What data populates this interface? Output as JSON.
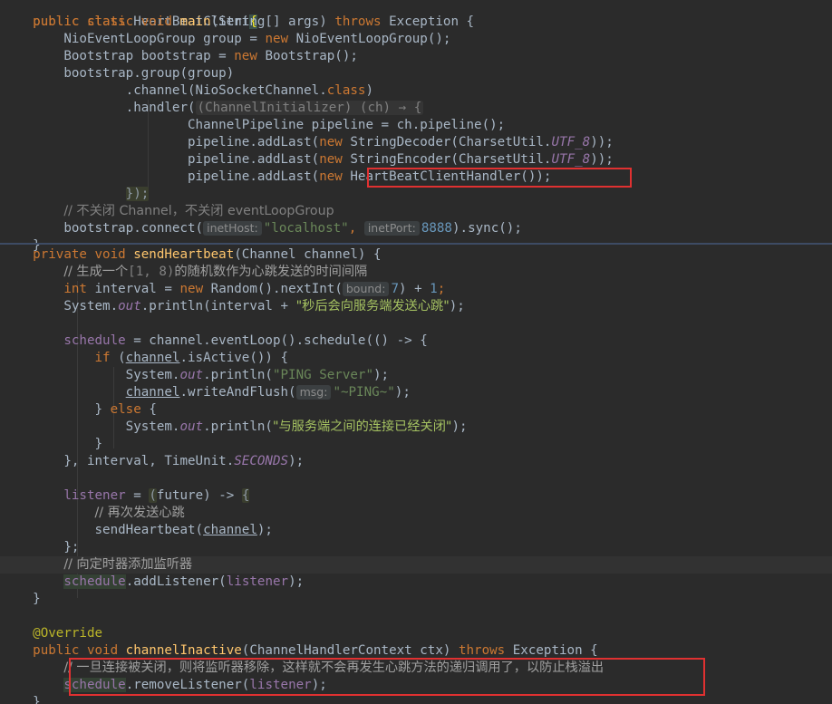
{
  "code": {
    "class_decl": [
      "public class ",
      "HeartBeatClient",
      " {"
    ],
    "main_sig": [
      "public static void ",
      "main",
      "(String[] args) ",
      "throws ",
      "Exception {"
    ],
    "l_group": [
      "NioEventLoopGroup group = ",
      "new ",
      "NioEventLoopGroup();"
    ],
    "l_bootstrap": [
      "Bootstrap bootstrap = ",
      "new ",
      "Bootstrap();"
    ],
    "l_bgroup": "bootstrap.group(group)",
    "l_channel": [
      ".channel(NioSocketChannel.",
      "class",
      ")"
    ],
    "l_handler_pre": ".handler(",
    "l_handler_fold": "(ChannelInitializer) (ch) → {",
    "l_pipeline": [
      "ChannelPipeline pipeline = ch.pipeline();"
    ],
    "l_add1": [
      "pipeline.addLast(",
      "new ",
      "StringDecoder(CharsetUtil.",
      "UTF_8",
      "));"
    ],
    "l_add2": [
      "pipeline.addLast(",
      "new ",
      "StringEncoder(CharsetUtil.",
      "UTF_8",
      "));"
    ],
    "l_add3": [
      "pipeline.addLast(",
      "new ",
      "HeartBeatClientHandler()",
      ");"
    ],
    "l_close": "});",
    "l_cmt1": "// 不关闭 Channel，不关闭 eventLoopGroup",
    "l_connect": [
      "bootstrap.connect(",
      "inetHost:",
      "\"localhost\"",
      ", ",
      "inetPort:",
      "8888",
      ").sync();"
    ],
    "l_brace1": "}",
    "send_sig": [
      "private void ",
      "sendHeartbeat",
      "(Channel channel) {"
    ],
    "l_cmt2": [
      "// 生成一个",
      "[1, 8)",
      "的随机数作为心跳发送的时间间隔"
    ],
    "l_interval": [
      "int ",
      "interval = ",
      "new ",
      "Random().nextInt(",
      "bound:",
      "7",
      ") + ",
      "1",
      ";"
    ],
    "l_println1": [
      "System.",
      "out",
      ".println(interval + ",
      "\"秒后会向服务端发送心跳\"",
      ");"
    ],
    "l_schedule": [
      "schedule",
      " = channel.eventLoop().schedule(() -> {"
    ],
    "l_if": [
      "if ",
      "(",
      "channel",
      ".isActive()) {"
    ],
    "l_ping": [
      "System.",
      "out",
      ".println(",
      "\"PING Server\"",
      ");"
    ],
    "l_write": [
      "channel",
      ".writeAndFlush(",
      "msg:",
      "\"~PING~\"",
      ");"
    ],
    "l_else": [
      "} ",
      "else ",
      "{"
    ],
    "l_println2": [
      "System.",
      "out",
      ".println(",
      "\"与服务端之间的连接已经关闭\"",
      ");"
    ],
    "l_brace2": "}",
    "l_interval_end": [
      "}, interval, TimeUnit.",
      "SECONDS",
      ");"
    ],
    "l_listener": [
      "listener",
      " = ",
      "(",
      "future) -> ",
      "{"
    ],
    "l_cmt3": "// 再次发送心跳",
    "l_resend": [
      "sendHeartbeat(",
      "channel",
      ");"
    ],
    "l_close2": "};",
    "l_cmt4": "// 向定时器添加监听器",
    "l_addlistener": [
      "schedule",
      ".addListener(",
      "listener",
      ");"
    ],
    "l_brace3": "}",
    "l_override": "@Override",
    "inactive_sig": [
      "public void ",
      "channelInactive",
      "(ChannelHandlerContext ctx) ",
      "throws ",
      "Exception {"
    ],
    "l_cmt5": "// 一旦连接被关闭，则将监听器移除，这样就不会再发生心跳方法的递归调用了，以防止栈溢出",
    "l_remove": [
      "schedule",
      ".removeListener(",
      "listener",
      ");"
    ],
    "l_brace4": "}"
  },
  "colors": {
    "background": "#2b2b2b",
    "keyword": "#cc7832",
    "string": "#6a8759",
    "number": "#6897bb",
    "function": "#ffc66d",
    "field": "#9876aa",
    "comment": "#808080",
    "annotation_box": "#e03131"
  }
}
